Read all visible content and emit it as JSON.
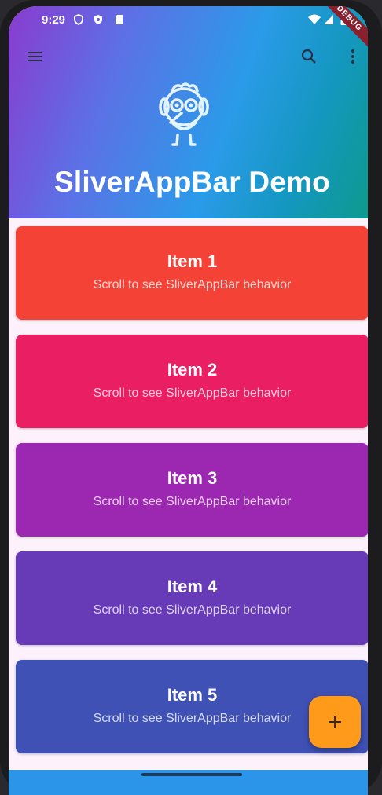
{
  "status_bar": {
    "time": "9:29"
  },
  "app_bar": {
    "title": "SliverAppBar Demo",
    "debug_banner": "DEBUG"
  },
  "items": [
    {
      "title": "Item 1",
      "subtitle": "Scroll to see SliverAppBar behavior",
      "color": "#f44336"
    },
    {
      "title": "Item 2",
      "subtitle": "Scroll to see SliverAppBar behavior",
      "color": "#e91e63"
    },
    {
      "title": "Item 3",
      "subtitle": "Scroll to see SliverAppBar behavior",
      "color": "#9c27b0"
    },
    {
      "title": "Item 4",
      "subtitle": "Scroll to see SliverAppBar behavior",
      "color": "#673ab7"
    },
    {
      "title": "Item 5",
      "subtitle": "Scroll to see SliverAppBar behavior",
      "color": "#3f51b5"
    }
  ],
  "colors": {
    "fab": "#ff9a1a",
    "bottom_bar": "#2b95ea"
  },
  "icons": {
    "menu": "menu-icon",
    "search": "search-icon",
    "more": "more-vert-icon",
    "logo": "bird-logo-icon",
    "fab": "add-icon"
  }
}
